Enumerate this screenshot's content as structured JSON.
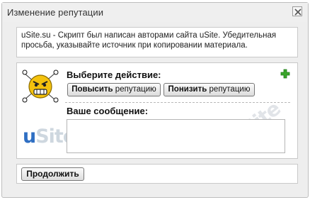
{
  "window": {
    "title": "Изменение репутации"
  },
  "notice": {
    "line1": "uSite.su - Скрипт был написан авторами сайта uSite. Убедительная",
    "line2": "просьба, указывайте источник при копировании материала."
  },
  "action": {
    "label": "Выберите действие:",
    "raise_bold": "Повысить",
    "raise_rest": " репутацию",
    "lower_bold": "Понизить",
    "lower_rest": " репутацию"
  },
  "message": {
    "label": "Ваше сообщение:",
    "value": ""
  },
  "watermark": {
    "u": "u",
    "rest": "Site"
  },
  "footer": {
    "continue_label": "Продолжить"
  },
  "colors": {
    "accent_blue": "#2f6fc3",
    "plus_green": "#3aa52b",
    "smiley_yellow": "#f4c20d"
  },
  "icons": [
    "close-icon",
    "angry-smiley-icon",
    "plus-icon"
  ]
}
